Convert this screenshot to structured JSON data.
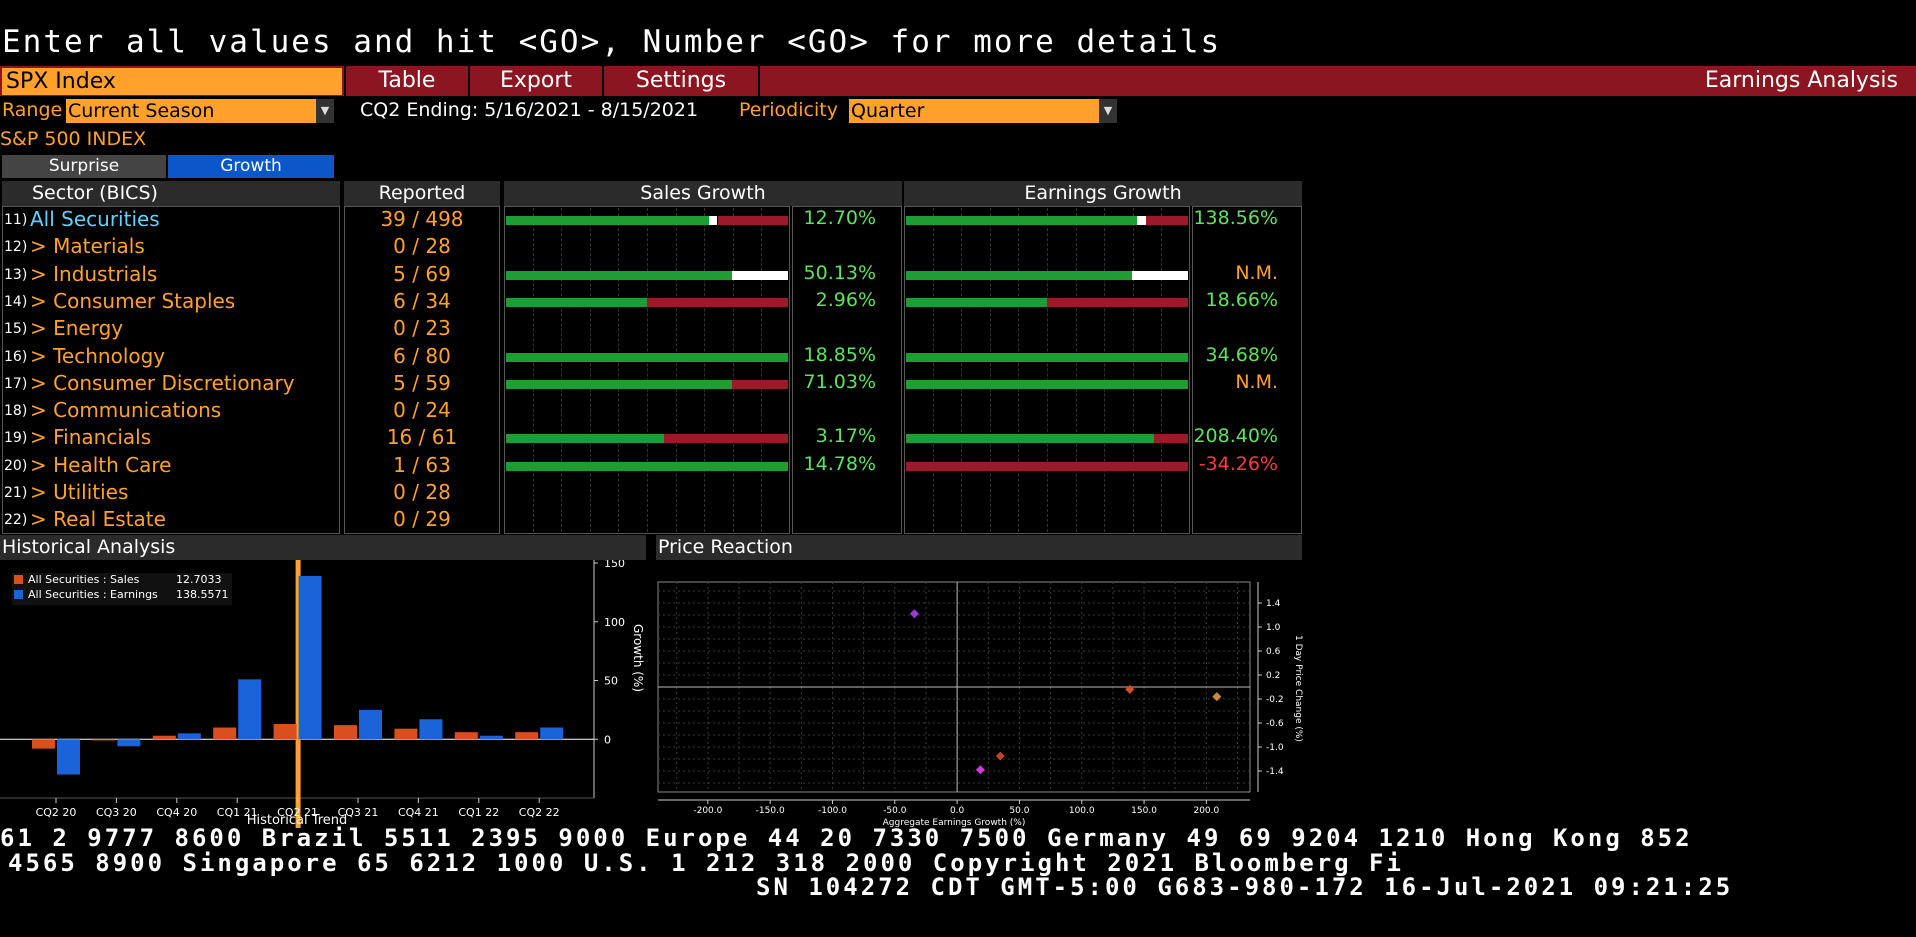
{
  "command_line": "Enter all values and hit <GO>, Number <GO> for more details",
  "ticker": "SPX Index",
  "menu": {
    "table": "Table",
    "export": "Export",
    "settings": "Settings",
    "title": "Earnings Analysis"
  },
  "controls": {
    "range_label": "Range",
    "range_value": "Current Season",
    "cq_ending": "CQ2 Ending: 5/16/2021 - 8/15/2021",
    "periodicity_label": "Periodicity",
    "periodicity_value": "Quarter"
  },
  "index_name": "S&P 500 INDEX",
  "toggle": {
    "surprise": "Surprise",
    "growth": "Growth"
  },
  "table_headers": {
    "sector": "Sector (BICS)",
    "reported": "Reported",
    "sales": "Sales Growth",
    "earnings": "Earnings Growth"
  },
  "rows": [
    {
      "num": "11)",
      "name": "All Securities",
      "reported": "39",
      "total": "498",
      "sales": "12.70%",
      "earn": "138.56%",
      "sf": [
        0.72,
        0.03,
        0.25
      ],
      "ef": [
        0.82,
        0.03,
        0.15
      ],
      "earn_color": "#5de35d",
      "name_color": "#5fd3ff"
    },
    {
      "num": "12)",
      "name": "> Materials",
      "reported": "0",
      "total": "28",
      "sales": "",
      "earn": "",
      "sf": null,
      "ef": null
    },
    {
      "num": "13)",
      "name": "> Industrials",
      "reported": "5",
      "total": "69",
      "sales": "50.13%",
      "earn": "N.M.",
      "sf": [
        0.8,
        0.2,
        0
      ],
      "ef": [
        0.8,
        0.2,
        0
      ],
      "earn_color": "#ffa12b"
    },
    {
      "num": "14)",
      "name": "> Consumer Staples",
      "reported": "6",
      "total": "34",
      "sales": "2.96%",
      "earn": "18.66%",
      "sf": [
        0.5,
        0,
        0.5
      ],
      "ef": [
        0.5,
        0,
        0.5
      ],
      "earn_color": "#5de35d"
    },
    {
      "num": "15)",
      "name": "> Energy",
      "reported": "0",
      "total": "23",
      "sales": "",
      "earn": "",
      "sf": null,
      "ef": null
    },
    {
      "num": "16)",
      "name": "> Technology",
      "reported": "6",
      "total": "80",
      "sales": "18.85%",
      "earn": "34.68%",
      "sf": [
        1,
        0,
        0
      ],
      "ef": [
        1,
        0,
        0
      ],
      "earn_color": "#5de35d"
    },
    {
      "num": "17)",
      "name": "> Consumer Discretionary",
      "reported": "5",
      "total": "59",
      "sales": "71.03%",
      "earn": "N.M.",
      "sf": [
        0.8,
        0,
        0.2
      ],
      "ef": [
        1,
        0,
        0
      ],
      "earn_color": "#ffa12b"
    },
    {
      "num": "18)",
      "name": "> Communications",
      "reported": "0",
      "total": "24",
      "sales": "",
      "earn": "",
      "sf": null,
      "ef": null
    },
    {
      "num": "19)",
      "name": "> Financials",
      "reported": "16",
      "total": "61",
      "sales": "3.17%",
      "earn": "208.40%",
      "sf": [
        0.56,
        0,
        0.44
      ],
      "ef": [
        0.88,
        0,
        0.12
      ],
      "earn_color": "#5de35d"
    },
    {
      "num": "20)",
      "name": "> Health Care",
      "reported": "1",
      "total": "63",
      "sales": "14.78%",
      "earn": "-34.26%",
      "sf": [
        1,
        0,
        0
      ],
      "ef": [
        0,
        0,
        1
      ],
      "earn_color": "#ff3b3b"
    },
    {
      "num": "21)",
      "name": "> Utilities",
      "reported": "0",
      "total": "28",
      "sales": "",
      "earn": "",
      "sf": null,
      "ef": null
    },
    {
      "num": "22)",
      "name": "> Real Estate",
      "reported": "0",
      "total": "29",
      "sales": "",
      "earn": "",
      "sf": null,
      "ef": null
    }
  ],
  "colors": {
    "green": "#1e9e32",
    "white": "#ffffff",
    "red": "#9b1a2a",
    "orange": "#ffa12b",
    "sales_bar": "#d9501e",
    "earn_bar": "#1a63d8"
  },
  "historical": {
    "title": "Historical Analysis",
    "legend_sales": "All Securities : Sales",
    "legend_sales_val": "12.7033",
    "legend_earn": "All Securities : Earnings",
    "legend_earn_val": "138.5571",
    "ylabel": "Growth (%)",
    "xlabel": "Historical Trend",
    "yticks": [
      "150",
      "100",
      "50",
      "0"
    ],
    "categories": [
      "CQ2 20",
      "CQ3 20",
      "CQ4 20",
      "CQ1 21",
      "CQ2 21",
      "CQ3 21",
      "CQ4 21",
      "CQ1 22",
      "CQ2 22"
    ],
    "sales": [
      -8,
      -1,
      3,
      10,
      13,
      12,
      9,
      6,
      6
    ],
    "earnings": [
      -30,
      -6,
      5,
      51,
      139,
      25,
      17,
      3,
      10
    ],
    "ymin": -50,
    "ymax": 150,
    "highlight": "CQ2 21"
  },
  "price_reaction": {
    "title": "Price Reaction",
    "ylabel": "1 Day Price Change (%)",
    "xlabel": "Aggregate Earnings Growth (%)",
    "xticks": [
      "-200.0",
      "-150.0",
      "-100.0",
      "-50.0",
      "0.0",
      "50.0",
      "100.0",
      "150.0",
      "200.0"
    ],
    "yticks": [
      "1.4",
      "1.0",
      "0.6",
      "0.2",
      "-0.2",
      "-0.6",
      "-1.0",
      "-1.4"
    ],
    "points": [
      {
        "x": -34.26,
        "y": 1.22,
        "color": "#9b3bd6"
      },
      {
        "x": 18.66,
        "y": -1.38,
        "color": "#d936d9"
      },
      {
        "x": 34.68,
        "y": -1.15,
        "color": "#c2412a"
      },
      {
        "x": 138.56,
        "y": -0.04,
        "color": "#d9501e"
      },
      {
        "x": 208.4,
        "y": -0.16,
        "color": "#c98a3a"
      }
    ],
    "xlim": [
      -240,
      235
    ],
    "ylim": [
      -1.75,
      1.75
    ]
  },
  "footer": {
    "line1": "61 2 9777 8600 Brazil 5511 2395 9000 Europe 44 20 7330 7500 Germany 49 69 9204 1210 Hong Kong 852",
    "line2": "4565 8900       Singapore 65 6212 1000       U.S. 1 212 318 2000        Copyright 2021 Bloomberg Fi",
    "line3": "SN 104272 CDT  GMT-5:00 G683-980-172 16-Jul-2021 09:21:25"
  }
}
